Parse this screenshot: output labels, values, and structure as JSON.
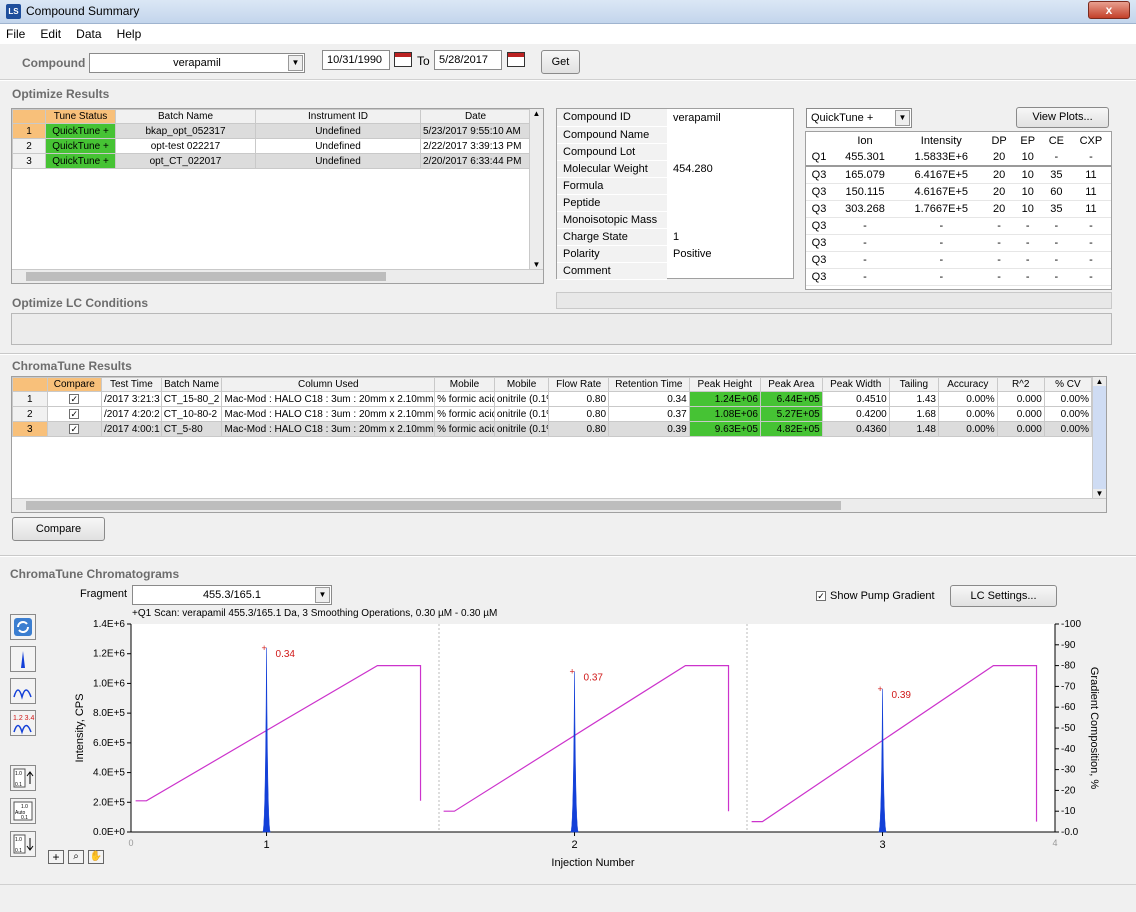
{
  "window": {
    "title": "Compound Summary",
    "app_badge": "LS",
    "close_label": "x"
  },
  "menu": [
    "File",
    "Edit",
    "Data",
    "Help"
  ],
  "toolbar": {
    "compound_label": "Compound",
    "compound_value": "verapamil",
    "date_from": "10/31/1990",
    "to_label": "To",
    "date_to": "5/28/2017",
    "get_label": "Get"
  },
  "optimize": {
    "title": "Optimize Results",
    "columns": [
      "Tune Status",
      "Batch Name",
      "Instrument ID",
      "Date"
    ],
    "rows": [
      {
        "n": "1",
        "status": "QuickTune +",
        "batch": "bkap_opt_052317",
        "instrument": "Undefined",
        "date": "5/23/2017 9:55:10 AM"
      },
      {
        "n": "2",
        "status": "QuickTune +",
        "batch": "opt-test 022217",
        "instrument": "Undefined",
        "date": "2/22/2017 3:39:13 PM"
      },
      {
        "n": "3",
        "status": "QuickTune +",
        "batch": "opt_CT_022017",
        "instrument": "Undefined",
        "date": "2/20/2017 6:33:44 PM"
      }
    ]
  },
  "properties": [
    {
      "k": "Compound ID",
      "v": "verapamil"
    },
    {
      "k": "Compound Name",
      "v": ""
    },
    {
      "k": "Compound Lot",
      "v": ""
    },
    {
      "k": "Molecular Weight",
      "v": "454.280"
    },
    {
      "k": "Formula",
      "v": ""
    },
    {
      "k": "Peptide",
      "v": ""
    },
    {
      "k": "Monoisotopic Mass",
      "v": ""
    },
    {
      "k": "Charge State",
      "v": "1"
    },
    {
      "k": "Polarity",
      "v": "Positive"
    },
    {
      "k": "Comment",
      "v": ""
    }
  ],
  "quicktune": {
    "select_value": "QuickTune +",
    "view_plots_label": "View Plots...",
    "columns": [
      "",
      "Ion",
      "Intensity",
      "DP",
      "EP",
      "CE",
      "CXP"
    ],
    "rows": [
      [
        "Q1",
        "455.301",
        "1.5833E+6",
        "20",
        "10",
        "-",
        "-"
      ],
      [
        "Q3",
        "165.079",
        "6.4167E+5",
        "20",
        "10",
        "35",
        "11"
      ],
      [
        "Q3",
        "150.115",
        "4.6167E+5",
        "20",
        "10",
        "60",
        "11"
      ],
      [
        "Q3",
        "303.268",
        "1.7667E+5",
        "20",
        "10",
        "35",
        "11"
      ],
      [
        "Q3",
        "-",
        "-",
        "-",
        "-",
        "-",
        "-"
      ],
      [
        "Q3",
        "-",
        "-",
        "-",
        "-",
        "-",
        "-"
      ],
      [
        "Q3",
        "-",
        "-",
        "-",
        "-",
        "-",
        "-"
      ],
      [
        "Q3",
        "-",
        "-",
        "-",
        "-",
        "-",
        "-"
      ]
    ]
  },
  "lc_conditions": {
    "title": "Optimize LC Conditions"
  },
  "chromatune": {
    "title": "ChromaTune Results",
    "columns": [
      "Compare",
      "Test Time",
      "Batch Name",
      "Column Used",
      "Mobile",
      "Mobile",
      "Flow Rate",
      "Retention Time",
      "Peak Height",
      "Peak Area",
      "Peak Width",
      "Tailing",
      "Accuracy",
      "R^2",
      "% CV"
    ],
    "rows": [
      {
        "n": "1",
        "checked": "✓",
        "time": "/2017 3:21:3",
        "batch": "CT_15-80_2",
        "column": "Mac-Mod : HALO C18 : 3um : 20mm x 2.10mm",
        "m1": "% formic acid",
        "m2": "onitrile (0.1% f",
        "flow": "0.80",
        "rt": "0.34",
        "height": "1.24E+06",
        "area": "6.44E+05",
        "width": "0.4510",
        "tailing": "1.43",
        "acc": "0.00%",
        "r2": "0.000",
        "cv": "0.00%"
      },
      {
        "n": "2",
        "checked": "✓",
        "time": "/2017 4:20:2",
        "batch": "CT_10-80-2",
        "column": "Mac-Mod : HALO C18 : 3um : 20mm x 2.10mm",
        "m1": "% formic acid",
        "m2": "onitrile (0.1% f",
        "flow": "0.80",
        "rt": "0.37",
        "height": "1.08E+06",
        "area": "5.27E+05",
        "width": "0.4200",
        "tailing": "1.68",
        "acc": "0.00%",
        "r2": "0.000",
        "cv": "0.00%"
      },
      {
        "n": "3",
        "checked": "✓",
        "time": "/2017 4:00:1",
        "batch": "CT_5-80",
        "column": "Mac-Mod : HALO C18 : 3um : 20mm x 2.10mm",
        "m1": "% formic acid",
        "m2": "onitrile (0.1% f",
        "flow": "0.80",
        "rt": "0.39",
        "height": "9.63E+05",
        "area": "4.82E+05",
        "width": "0.4360",
        "tailing": "1.48",
        "acc": "0.00%",
        "r2": "0.000",
        "cv": "0.00%"
      }
    ],
    "compare_label": "Compare"
  },
  "chromatograms": {
    "title": "ChromaTune Chromatograms",
    "fragment_label": "Fragment",
    "fragment_value": "455.3/165.1",
    "show_pump_label": "Show Pump Gradient",
    "lc_settings_label": "LC Settings...",
    "scan_caption": "+Q1 Scan: verapamil 455.3/165.1 Da, 3 Smoothing Operations, 0.30 µM - 0.30 µM"
  },
  "chart_data": {
    "type": "line",
    "xlabel": "Injection Number",
    "ylabel": "Intensity, CPS",
    "y2label": "Gradient Composition, %",
    "yticks": [
      "0.0E+0",
      "2.0E+5",
      "4.0E+5",
      "6.0E+5",
      "8.0E+5",
      "1.0E+6",
      "1.2E+6",
      "1.4E+6"
    ],
    "ylim": [
      0,
      1400000
    ],
    "y2ticks": [
      "0.0",
      "10",
      "20",
      "30",
      "40",
      "50",
      "60",
      "70",
      "80",
      "90",
      "100"
    ],
    "y2lim": [
      0,
      100
    ],
    "xticks": [
      "1",
      "2",
      "3"
    ],
    "x_range_labels": [
      "0",
      "4"
    ],
    "peaks": [
      {
        "injection": 1,
        "rt": 0.34,
        "height": 1240000,
        "label": "0.34"
      },
      {
        "injection": 2,
        "rt": 0.37,
        "height": 1080000,
        "label": "0.37"
      },
      {
        "injection": 3,
        "rt": 0.39,
        "height": 963000,
        "label": "0.39"
      }
    ],
    "gradients": [
      {
        "injection": 1,
        "start": 15,
        "end": 80
      },
      {
        "injection": 2,
        "start": 10,
        "end": 80
      },
      {
        "injection": 3,
        "start": 5,
        "end": 80
      }
    ],
    "colors": {
      "peak": "#1340d8",
      "gradient": "#cc33cc",
      "label": "#d01818"
    }
  }
}
